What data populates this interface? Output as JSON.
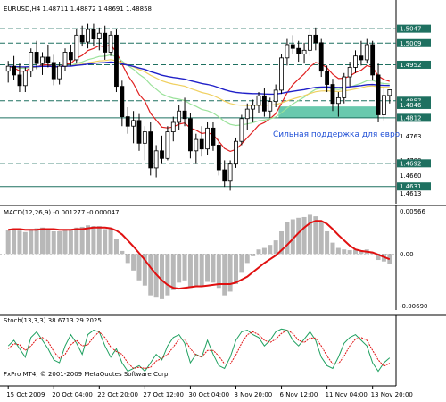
{
  "chart_data": {
    "type": "candlestick",
    "symbol_header": "EURUSD,H4 1.48711 1.48872 1.48691 1.48858",
    "copyright": "FxPro MT4, © 2001-2009 MetaQuotes Software Corp.",
    "annotation": "Сильная поддержка для евро",
    "price_axis": {
      "min": 1.4595,
      "max": 1.5085,
      "ticks": [
        "1.5047",
        "1.5009",
        "1.4952",
        "1.4857",
        "1.4846",
        "1.4812",
        "1.4763",
        "1.4700",
        "1.4692",
        "1.4660",
        "1.4631",
        "1.4613"
      ],
      "tick_values": [
        1.5047,
        1.5009,
        1.4952,
        1.4857,
        1.4846,
        1.4812,
        1.4763,
        1.47,
        1.4692,
        1.466,
        1.4631,
        1.4613
      ],
      "highlighted_ticks": [
        {
          "label": "1.5047",
          "value": 1.5047
        },
        {
          "label": "1.5009",
          "value": 1.5009
        },
        {
          "label": "1.4952",
          "value": 1.4952
        },
        {
          "label": "1.4857",
          "value": 1.4857
        },
        {
          "label": "1.4846",
          "value": 1.4846
        },
        {
          "label": "1.4812",
          "value": 1.4812
        },
        {
          "label": "1.4692",
          "value": 1.4692
        },
        {
          "label": "1.4631",
          "value": 1.4631
        }
      ]
    },
    "levels": [
      1.5047,
      1.5009,
      1.4952,
      1.4857,
      1.4846,
      1.4812,
      1.4692,
      1.4631
    ],
    "support_zone": {
      "from_index": 48,
      "low": 1.4812,
      "high": 1.4842,
      "color": "#4fbfa0"
    },
    "x_axis": {
      "labels": [
        "15 Oct 2009",
        "20 Oct 04:00",
        "22 Oct 20:00",
        "27 Oct 12:00",
        "30 Oct 04:00",
        "3 Nov 20:00",
        "6 Nov 12:00",
        "11 Nov 04:00",
        "13 Nov 20:00"
      ],
      "label_indices": [
        0,
        8,
        16,
        24,
        32,
        40,
        48,
        56,
        64
      ]
    },
    "candles": [
      {
        "o": 1.4935,
        "h": 1.4962,
        "l": 1.4905,
        "c": 1.4948
      },
      {
        "o": 1.4948,
        "h": 1.4975,
        "l": 1.4912,
        "c": 1.4925
      },
      {
        "o": 1.4925,
        "h": 1.4955,
        "l": 1.488,
        "c": 1.4897
      },
      {
        "o": 1.4897,
        "h": 1.4945,
        "l": 1.488,
        "c": 1.4935
      },
      {
        "o": 1.4935,
        "h": 1.4995,
        "l": 1.492,
        "c": 1.4985
      },
      {
        "o": 1.4985,
        "h": 1.5015,
        "l": 1.494,
        "c": 1.4955
      },
      {
        "o": 1.4955,
        "h": 1.4985,
        "l": 1.4925,
        "c": 1.4972
      },
      {
        "o": 1.4972,
        "h": 1.5005,
        "l": 1.4945,
        "c": 1.4958
      },
      {
        "o": 1.4958,
        "h": 1.4978,
        "l": 1.4898,
        "c": 1.4915
      },
      {
        "o": 1.4915,
        "h": 1.496,
        "l": 1.49,
        "c": 1.4948
      },
      {
        "o": 1.4948,
        "h": 1.4995,
        "l": 1.4935,
        "c": 1.4985
      },
      {
        "o": 1.4985,
        "h": 1.5005,
        "l": 1.495,
        "c": 1.4965
      },
      {
        "o": 1.4965,
        "h": 1.5045,
        "l": 1.4955,
        "c": 1.503
      },
      {
        "o": 1.503,
        "h": 1.5055,
        "l": 1.5,
        "c": 1.5012
      },
      {
        "o": 1.5012,
        "h": 1.506,
        "l": 1.4995,
        "c": 1.5045
      },
      {
        "o": 1.5045,
        "h": 1.506,
        "l": 1.5,
        "c": 1.502
      },
      {
        "o": 1.502,
        "h": 1.505,
        "l": 1.499,
        "c": 1.5035
      },
      {
        "o": 1.5035,
        "h": 1.5055,
        "l": 1.4965,
        "c": 1.4985
      },
      {
        "o": 1.4985,
        "h": 1.504,
        "l": 1.4975,
        "c": 1.503
      },
      {
        "o": 1.503,
        "h": 1.5045,
        "l": 1.488,
        "c": 1.4895
      },
      {
        "o": 1.4895,
        "h": 1.491,
        "l": 1.479,
        "c": 1.4815
      },
      {
        "o": 1.4815,
        "h": 1.484,
        "l": 1.477,
        "c": 1.479
      },
      {
        "o": 1.479,
        "h": 1.483,
        "l": 1.4745,
        "c": 1.4805
      },
      {
        "o": 1.4805,
        "h": 1.4822,
        "l": 1.4725,
        "c": 1.4745
      },
      {
        "o": 1.4745,
        "h": 1.479,
        "l": 1.47,
        "c": 1.4775
      },
      {
        "o": 1.4775,
        "h": 1.48,
        "l": 1.466,
        "c": 1.468
      },
      {
        "o": 1.468,
        "h": 1.474,
        "l": 1.4655,
        "c": 1.4725
      },
      {
        "o": 1.4725,
        "h": 1.4765,
        "l": 1.469,
        "c": 1.4705
      },
      {
        "o": 1.4705,
        "h": 1.479,
        "l": 1.47,
        "c": 1.4775
      },
      {
        "o": 1.4775,
        "h": 1.4815,
        "l": 1.475,
        "c": 1.48
      },
      {
        "o": 1.48,
        "h": 1.4845,
        "l": 1.478,
        "c": 1.483
      },
      {
        "o": 1.483,
        "h": 1.4865,
        "l": 1.479,
        "c": 1.481
      },
      {
        "o": 1.481,
        "h": 1.4825,
        "l": 1.4705,
        "c": 1.4725
      },
      {
        "o": 1.4725,
        "h": 1.477,
        "l": 1.469,
        "c": 1.4755
      },
      {
        "o": 1.4755,
        "h": 1.479,
        "l": 1.471,
        "c": 1.473
      },
      {
        "o": 1.473,
        "h": 1.48,
        "l": 1.4715,
        "c": 1.4785
      },
      {
        "o": 1.4785,
        "h": 1.48,
        "l": 1.4725,
        "c": 1.474
      },
      {
        "o": 1.474,
        "h": 1.476,
        "l": 1.466,
        "c": 1.4675
      },
      {
        "o": 1.4675,
        "h": 1.47,
        "l": 1.463,
        "c": 1.4645
      },
      {
        "o": 1.4645,
        "h": 1.47,
        "l": 1.462,
        "c": 1.469
      },
      {
        "o": 1.469,
        "h": 1.476,
        "l": 1.468,
        "c": 1.475
      },
      {
        "o": 1.475,
        "h": 1.482,
        "l": 1.474,
        "c": 1.481
      },
      {
        "o": 1.481,
        "h": 1.485,
        "l": 1.478,
        "c": 1.4835
      },
      {
        "o": 1.4835,
        "h": 1.486,
        "l": 1.48,
        "c": 1.4845
      },
      {
        "o": 1.4845,
        "h": 1.488,
        "l": 1.4825,
        "c": 1.487
      },
      {
        "o": 1.487,
        "h": 1.489,
        "l": 1.4815,
        "c": 1.483
      },
      {
        "o": 1.483,
        "h": 1.4865,
        "l": 1.4812,
        "c": 1.4855
      },
      {
        "o": 1.4855,
        "h": 1.49,
        "l": 1.484,
        "c": 1.4885
      },
      {
        "o": 1.4885,
        "h": 1.498,
        "l": 1.4875,
        "c": 1.497
      },
      {
        "o": 1.497,
        "h": 1.502,
        "l": 1.495,
        "c": 1.5005
      },
      {
        "o": 1.5005,
        "h": 1.503,
        "l": 1.498,
        "c": 1.4995
      },
      {
        "o": 1.4995,
        "h": 1.5015,
        "l": 1.496,
        "c": 1.498
      },
      {
        "o": 1.498,
        "h": 1.501,
        "l": 1.4955,
        "c": 1.499
      },
      {
        "o": 1.499,
        "h": 1.5045,
        "l": 1.4975,
        "c": 1.503
      },
      {
        "o": 1.503,
        "h": 1.505,
        "l": 1.499,
        "c": 1.501
      },
      {
        "o": 1.501,
        "h": 1.502,
        "l": 1.492,
        "c": 1.4935
      },
      {
        "o": 1.4935,
        "h": 1.495,
        "l": 1.488,
        "c": 1.49
      },
      {
        "o": 1.49,
        "h": 1.4915,
        "l": 1.483,
        "c": 1.485
      },
      {
        "o": 1.485,
        "h": 1.488,
        "l": 1.4815,
        "c": 1.4865
      },
      {
        "o": 1.4865,
        "h": 1.493,
        "l": 1.485,
        "c": 1.492
      },
      {
        "o": 1.492,
        "h": 1.496,
        "l": 1.4895,
        "c": 1.4945
      },
      {
        "o": 1.4945,
        "h": 1.499,
        "l": 1.493,
        "c": 1.4975
      },
      {
        "o": 1.4975,
        "h": 1.5015,
        "l": 1.495,
        "c": 1.4965
      },
      {
        "o": 1.4965,
        "h": 1.502,
        "l": 1.4955,
        "c": 1.5005
      },
      {
        "o": 1.5005,
        "h": 1.5015,
        "l": 1.491,
        "c": 1.4925
      },
      {
        "o": 1.4925,
        "h": 1.4955,
        "l": 1.48,
        "c": 1.482
      },
      {
        "o": 1.482,
        "h": 1.489,
        "l": 1.4805,
        "c": 1.4871
      },
      {
        "o": 1.4871,
        "h": 1.4887,
        "l": 1.485,
        "c": 1.4886
      }
    ],
    "macd": {
      "label": "MACD(12,26,9) -0.001277 -0.000047",
      "range": [
        -0.0072,
        0.0062
      ],
      "ticks": [
        {
          "label": "0.00566",
          "value": 0.00566
        },
        {
          "label": "0.00",
          "value": 0
        },
        {
          "label": "-0.00690",
          "value": -0.0069
        }
      ],
      "histogram": [
        0.0032,
        0.0034,
        0.0031,
        0.0029,
        0.0033,
        0.0034,
        0.0035,
        0.0034,
        0.003,
        0.003,
        0.0032,
        0.0031,
        0.0035,
        0.0036,
        0.0038,
        0.0037,
        0.0037,
        0.0033,
        0.0033,
        0.002,
        0.0004,
        -0.0012,
        -0.0022,
        -0.0035,
        -0.0042,
        -0.0055,
        -0.0058,
        -0.006,
        -0.0055,
        -0.0048,
        -0.0038,
        -0.0035,
        -0.0045,
        -0.0043,
        -0.0043,
        -0.0037,
        -0.0038,
        -0.0045,
        -0.0055,
        -0.005,
        -0.004,
        -0.0025,
        -0.0012,
        -0.0003,
        0.0006,
        0.0008,
        0.0012,
        0.0018,
        0.003,
        0.0042,
        0.0046,
        0.0048,
        0.0049,
        0.0052,
        0.005,
        0.0042,
        0.003,
        0.0015,
        0.0008,
        0.0006,
        0.0005,
        0.0006,
        0.0004,
        0.0006,
        0.0002,
        -0.0008,
        -0.001,
        -0.0013
      ],
      "signal": [
        0.0032,
        0.0033,
        0.0033,
        0.0032,
        0.0032,
        0.0032,
        0.0033,
        0.0033,
        0.0033,
        0.0032,
        0.0032,
        0.0032,
        0.0033,
        0.0033,
        0.0034,
        0.0035,
        0.0035,
        0.0035,
        0.0034,
        0.0031,
        0.0026,
        0.0018,
        0.001,
        0.0001,
        -0.0008,
        -0.0018,
        -0.0027,
        -0.0035,
        -0.0041,
        -0.0045,
        -0.0046,
        -0.0045,
        -0.0044,
        -0.0043,
        -0.0043,
        -0.0042,
        -0.0041,
        -0.004,
        -0.004,
        -0.004,
        -0.0038,
        -0.0034,
        -0.003,
        -0.0024,
        -0.0018,
        -0.0012,
        -0.0007,
        -0.0002,
        0.0005,
        0.0012,
        0.002,
        0.0028,
        0.0035,
        0.0041,
        0.0044,
        0.0044,
        0.004,
        0.0033,
        0.0025,
        0.0018,
        0.0011,
        0.0006,
        0.0004,
        0.0003,
        0.0002,
        -0.0001,
        -0.0004,
        -0.0007
      ]
    },
    "stoch": {
      "label": "Stoch(13,3,3) 38.6713 29.2025",
      "range": [
        0,
        100
      ],
      "main": [
        60,
        70,
        55,
        40,
        75,
        85,
        70,
        55,
        35,
        30,
        60,
        80,
        65,
        45,
        80,
        88,
        85,
        60,
        40,
        55,
        30,
        15,
        20,
        25,
        15,
        30,
        45,
        35,
        60,
        75,
        80,
        65,
        30,
        45,
        40,
        70,
        45,
        25,
        20,
        40,
        70,
        85,
        88,
        80,
        75,
        60,
        70,
        85,
        90,
        88,
        70,
        60,
        72,
        85,
        70,
        40,
        25,
        20,
        40,
        65,
        75,
        80,
        70,
        60,
        30,
        15,
        30,
        38.67
      ],
      "signal": [
        55,
        64,
        62,
        52,
        60,
        72,
        75,
        68,
        50,
        38,
        45,
        62,
        70,
        60,
        62,
        76,
        85,
        75,
        58,
        50,
        45,
        30,
        20,
        22,
        20,
        22,
        33,
        38,
        45,
        58,
        72,
        72,
        55,
        44,
        40,
        52,
        52,
        42,
        28,
        28,
        44,
        65,
        80,
        85,
        80,
        70,
        66,
        72,
        82,
        88,
        82,
        70,
        66,
        74,
        74,
        60,
        42,
        28,
        28,
        42,
        60,
        72,
        75,
        70,
        52,
        35,
        24,
        29.2
      ]
    }
  }
}
